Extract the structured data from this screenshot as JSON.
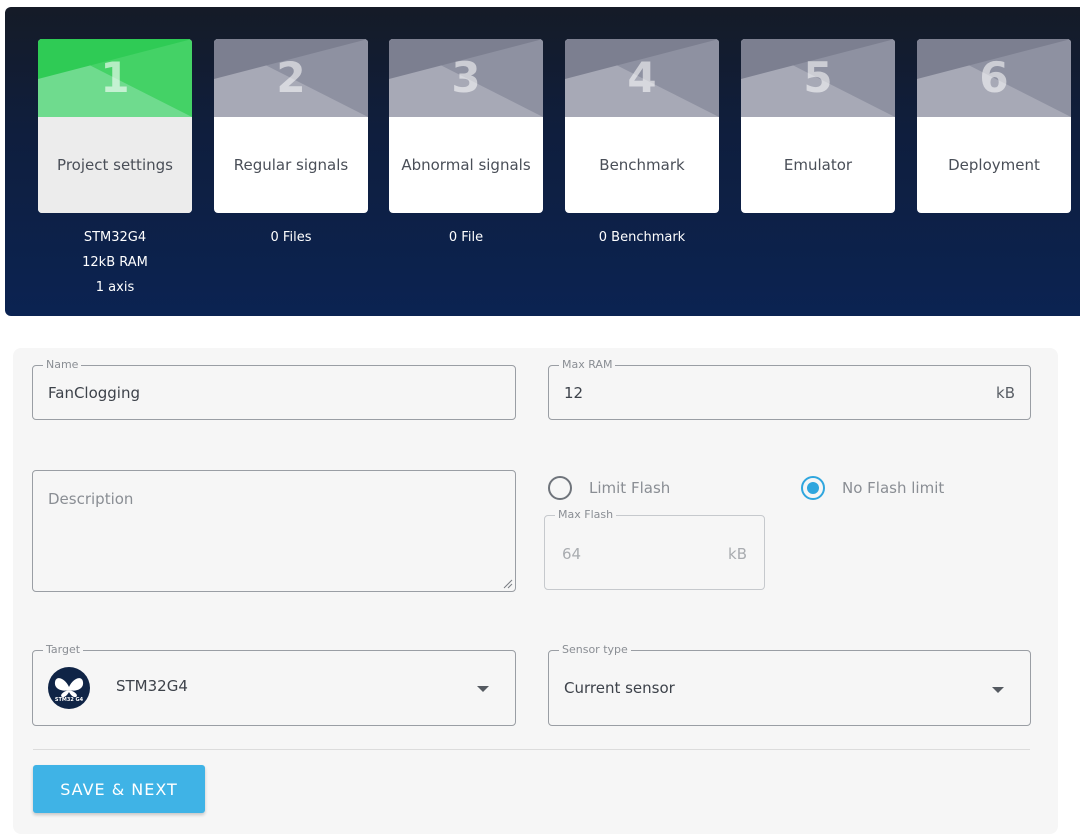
{
  "stepper": {
    "steps": [
      {
        "number": "1",
        "label": "Project settings",
        "info": [
          "STM32G4",
          "12kB RAM",
          "1 axis"
        ],
        "active": true
      },
      {
        "number": "2",
        "label": "Regular signals",
        "info": [
          "0 Files"
        ],
        "active": false
      },
      {
        "number": "3",
        "label": "Abnormal signals",
        "info": [
          "0 File"
        ],
        "active": false
      },
      {
        "number": "4",
        "label": "Benchmark",
        "info": [
          "0 Benchmark"
        ],
        "active": false
      },
      {
        "number": "5",
        "label": "Emulator",
        "info": [],
        "active": false
      },
      {
        "number": "6",
        "label": "Deployment",
        "info": [],
        "active": false
      }
    ]
  },
  "form": {
    "name": {
      "legend": "Name",
      "value": "FanClogging"
    },
    "max_ram": {
      "legend": "Max RAM",
      "value": "12",
      "unit": "kB"
    },
    "description": {
      "placeholder": "Description",
      "value": ""
    },
    "flash": {
      "limit_label": "Limit Flash",
      "no_limit_label": "No Flash limit",
      "selected": "No Flash limit",
      "max_flash": {
        "legend": "Max Flash",
        "value": "64",
        "unit": "kB"
      }
    },
    "target": {
      "legend": "Target",
      "value": "STM32G4",
      "icon": "stm32-butterfly-icon",
      "logo_text": "STM32 G4"
    },
    "sensor_type": {
      "legend": "Sensor type",
      "value": "Current sensor"
    },
    "save_label": "SAVE & NEXT"
  },
  "colors": {
    "active_step": "#3ecf5e",
    "inactive_step": "#9a9cab",
    "accent": "#3fb3e6",
    "header_bg": "#0b2352"
  }
}
